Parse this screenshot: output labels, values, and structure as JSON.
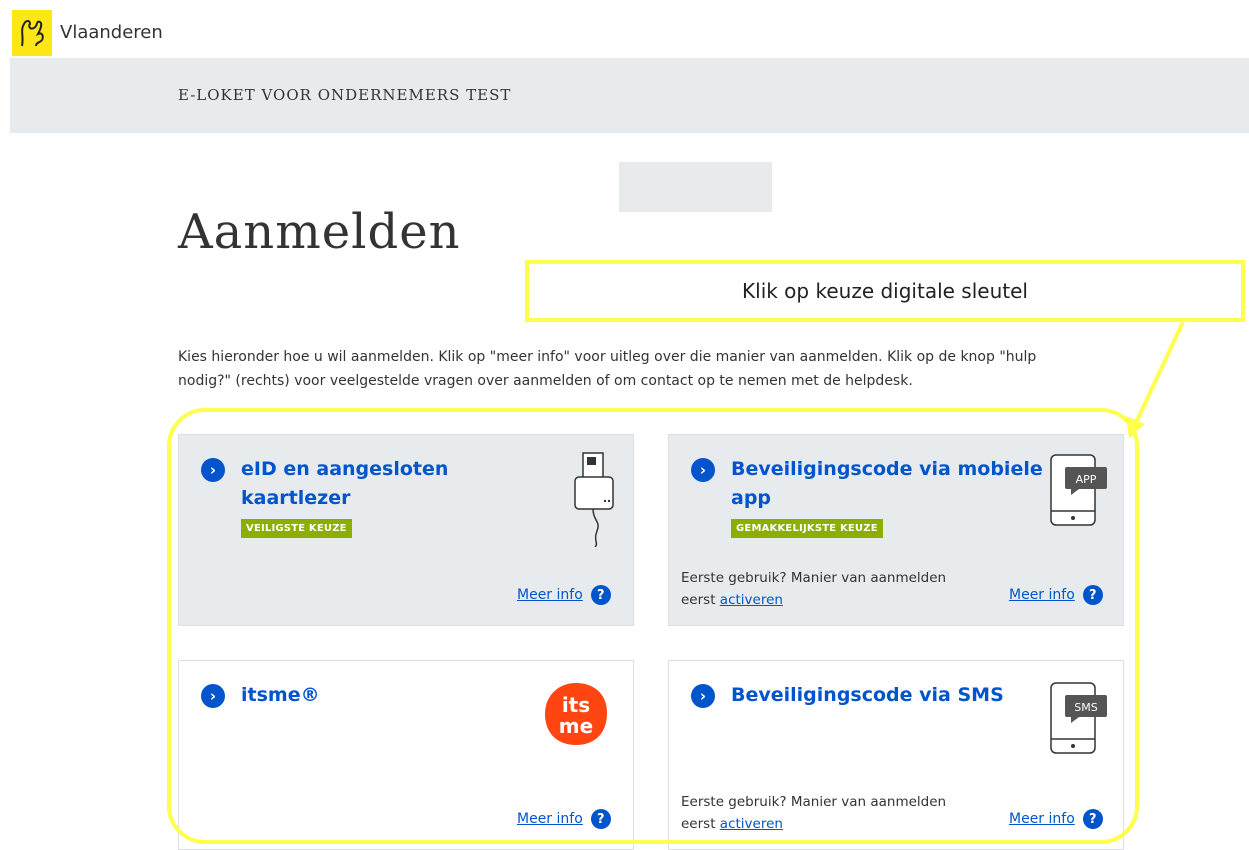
{
  "brand": {
    "name": "Vlaanderen",
    "logo_color": "#ffe615"
  },
  "header": {
    "title": "E-LOKET VOOR ONDERNEMERS TEST"
  },
  "page": {
    "title": "Aanmelden",
    "intro": "Kies hieronder hoe u wil aanmelden. Klik op \"meer info\" voor uitleg over die manier van aanmelden. Klik op de knop \"hulp nodig?\" (rechts) voor veelgestelde vragen over aanmelden of om contact op te nemen met de helpdesk."
  },
  "annotation": {
    "callout_text": "Klik op keuze digitale sleutel",
    "highlight_color": "#ffff4d"
  },
  "options": [
    {
      "title_line1": "eID en aangesloten",
      "title_line2": "kaartlezer",
      "badge": "VEILIGSTE KEUZE",
      "meer_info": "Meer info",
      "icon": "card-reader-icon"
    },
    {
      "title_line1": "Beveiligingscode via mobiele",
      "title_line2": "app",
      "badge": "GEMAKKELIJKSTE KEUZE",
      "first_use_line1": "Eerste gebruik? Manier van aanmelden",
      "first_use_prefix": "eerst",
      "first_use_link": "activeren",
      "meer_info": "Meer info",
      "icon": "phone-app-icon",
      "icon_label": "APP"
    },
    {
      "title": "itsme®",
      "meer_info": "Meer info",
      "icon": "itsme-logo",
      "logo_color": "#ff4612"
    },
    {
      "title": "Beveiligingscode via SMS",
      "first_use_line1": "Eerste gebruik? Manier van aanmelden",
      "first_use_prefix": "eerst",
      "first_use_link": "activeren",
      "meer_info": "Meer info",
      "icon": "phone-sms-icon",
      "icon_label": "SMS"
    }
  ],
  "help_icon": "?",
  "chevron_icon": "›",
  "accent_color": "#0055cc",
  "badge_color": "#8bae00"
}
